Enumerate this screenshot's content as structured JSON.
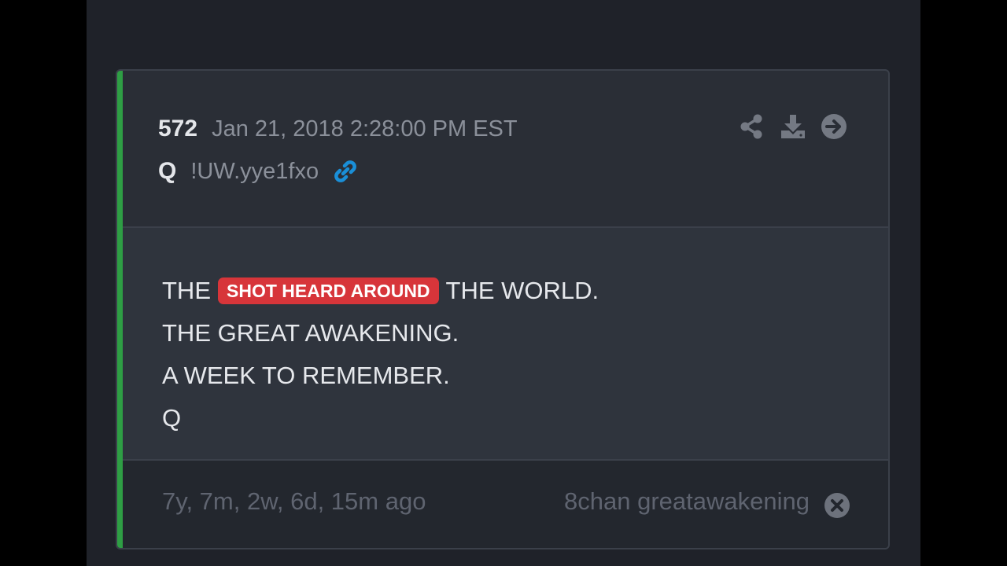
{
  "post": {
    "number": "572",
    "date": "Jan 21, 2018 2:28:00 PM EST",
    "author": "Q",
    "tripcode": "!UW.yye1fxo",
    "accent_color": "#2e9e44",
    "link_color": "#1a8fd8"
  },
  "actions": {
    "share_icon": "share-icon",
    "download_icon": "download-icon",
    "next_icon": "arrow-right-circle-icon"
  },
  "body": {
    "line1_pre": "THE",
    "line1_highlight": "SHOT HEARD AROUND",
    "line1_post": "THE WORLD.",
    "line2": "THE GREAT AWAKENING.",
    "line3": "A WEEK TO REMEMBER.",
    "line4": "Q",
    "highlight_color": "#d7353a"
  },
  "footer": {
    "age": "7y, 7m, 2w, 6d, 15m ago",
    "source": "8chan greatawakening",
    "close_icon": "close-circle-icon"
  }
}
